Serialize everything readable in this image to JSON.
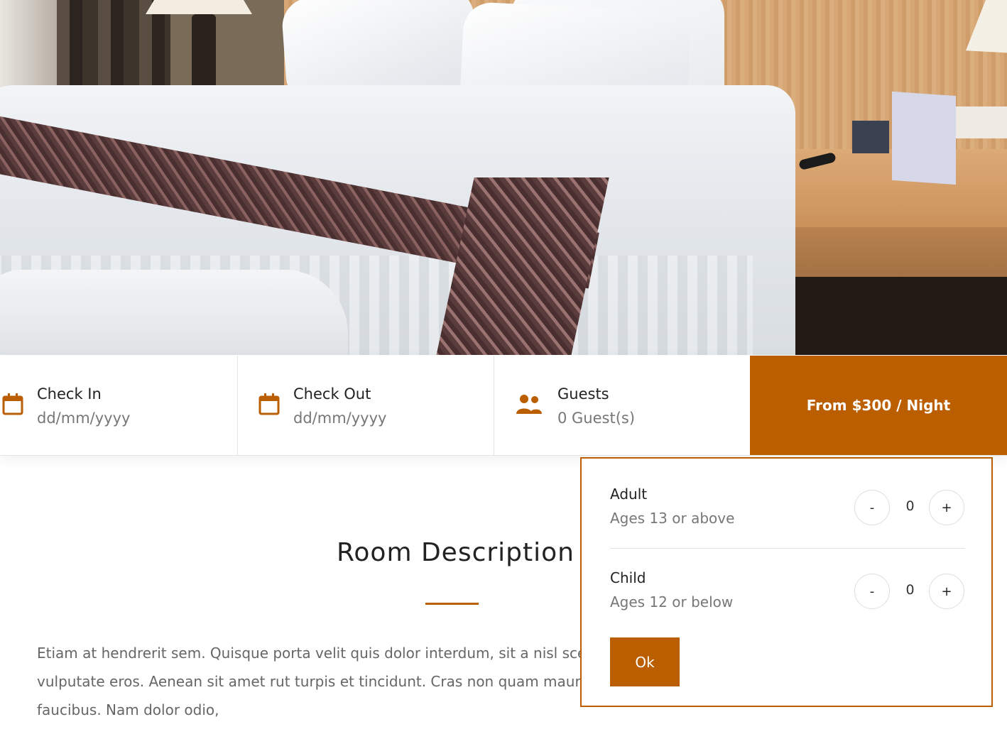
{
  "colors": {
    "accent": "#bb5e00",
    "text": "#222222",
    "muted": "#777777"
  },
  "booking": {
    "check_in": {
      "label": "Check In",
      "value": "dd/mm/yyyy",
      "icon": "calendar-icon"
    },
    "check_out": {
      "label": "Check Out",
      "value": "dd/mm/yyyy",
      "icon": "calendar-icon"
    },
    "guests": {
      "label": "Guests",
      "value": "0 Guest(s)",
      "icon": "users-icon"
    },
    "price_button": "From $300 / Night"
  },
  "content": {
    "title": "Room Description",
    "description": "Etiam at hendrerit sem. Quisque porta velit quis dolor interdum, sit a nisl scelerisque, commodo ex vel, vulputate eros. Aenean sit amet rut turpis et tincidunt. Cras non quam mauris. Nullam commodo a urna sed faucibus. Nam dolor odio,"
  },
  "guest_popup": {
    "adult": {
      "label": "Adult",
      "sub": "Ages 13 or above",
      "count": "0"
    },
    "child": {
      "label": "Child",
      "sub": "Ages 12 or below",
      "count": "0"
    },
    "minus_label": "-",
    "plus_label": "+",
    "ok_label": "Ok"
  }
}
